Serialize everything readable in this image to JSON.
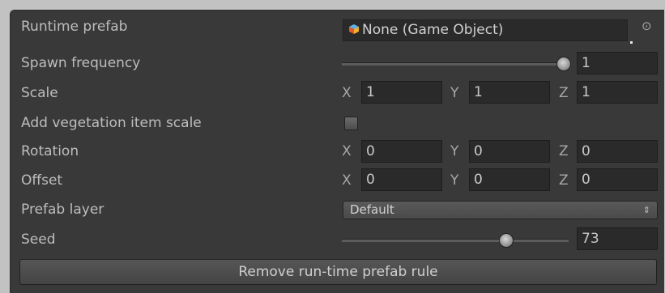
{
  "rows": {
    "runtime_prefab": {
      "label": "Runtime prefab",
      "value": "None (Game Object)",
      "icon": "cube-icon"
    },
    "spawn_frequency": {
      "label": "Spawn frequency",
      "value": "1",
      "fraction": 1.0
    },
    "scale": {
      "label": "Scale",
      "x_axis": "X",
      "x": "1",
      "y_axis": "Y",
      "y": "1",
      "z_axis": "Z",
      "z": "1"
    },
    "add_vegetation_item_scale": {
      "label": "Add vegetation item scale",
      "checked": false
    },
    "rotation": {
      "label": "Rotation",
      "x_axis": "X",
      "x": "0",
      "y_axis": "Y",
      "y": "0",
      "z_axis": "Z",
      "z": "0"
    },
    "offset": {
      "label": "Offset",
      "x_axis": "X",
      "x": "0",
      "y_axis": "Y",
      "y": "0",
      "z_axis": "Z",
      "z": "0"
    },
    "prefab_layer": {
      "label": "Prefab layer",
      "value": "Default"
    },
    "seed": {
      "label": "Seed",
      "value": "73",
      "fraction": 0.73
    }
  },
  "remove_button_label": "Remove run-time prefab rule",
  "colors": {
    "panel_bg": "#393939",
    "field_bg": "#2a2a2a",
    "text": "#bdbdbd"
  }
}
